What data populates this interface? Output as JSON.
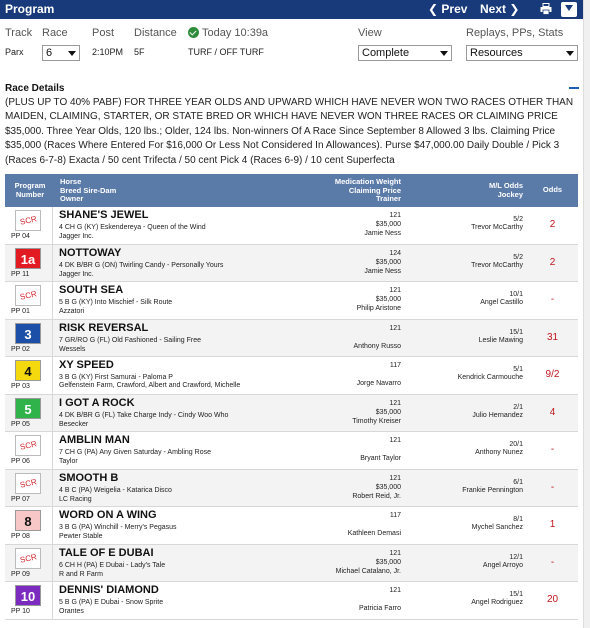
{
  "header": {
    "title": "Program",
    "prev_label": "Prev",
    "next_label": "Next"
  },
  "filters": {
    "track_label": "Track",
    "track_value": "Parx",
    "race_label": "Race",
    "race_value": "6",
    "post_label": "Post",
    "post_value": "2:10PM",
    "distance_label": "Distance",
    "distance_value": "5F",
    "status_text": "Today 10:39a",
    "surface_value": "TURF / OFF TURF",
    "view_label": "View",
    "view_value": "Complete",
    "replays_label": "Replays, PPs, Stats",
    "resources_value": "Resources"
  },
  "race_details": {
    "title": "Race Details",
    "text": "(PLUS UP TO 40% PABF) FOR THREE YEAR OLDS AND UPWARD WHICH HAVE NEVER WON TWO RACES OTHER THAN MAIDEN, CLAIMING, STARTER, OR STATE BRED OR WHICH HAVE NEVER WON THREE RACES OR CLAIMING PRICE $35,000. Three Year Olds, 120 lbs.; Older, 124 lbs. Non-winners Of A Race Since September 8 Allowed 3 lbs. Claiming Price $35,000 (Races Where Entered For $16,000 Or Less Not Considered In Allowances). Purse $47,000.00 Daily Double / Pick 3 (Races 6-7-8) Exacta / 50 cent Trifecta / 50 cent Pick 4 (Races 6-9) / 10 cent Superfecta"
  },
  "table": {
    "col_program_line1": "Program",
    "col_program_line2": "Number",
    "col_horse_line1": "Horse",
    "col_horse_line2": "Breed Sire-Dam",
    "col_horse_line3": "Owner",
    "col_mwc_line1": "Medication Weight",
    "col_mwc_line2": "Claiming Price",
    "col_mwc_line3": "Trainer",
    "col_ml_line1": "M/L Odds",
    "col_ml_line2": "Jockey",
    "col_odds": "Odds"
  },
  "colors": {
    "header_bg": "#183a7a",
    "table_header_bg": "#5a7aa8",
    "odds_red": "#c0151b",
    "scratch_red": "#d2232a"
  },
  "entries": [
    {
      "badge": "SCR",
      "scratched": true,
      "badge_bg": "#ffffff",
      "badge_fg": "#d2232a",
      "pp": "PP 04",
      "name": "SHANE'S JEWEL",
      "sire": "4 CH G (KY) Eskendereya - Queen of the Wind",
      "owner": "Jagger Inc.",
      "weight": "121",
      "claim": "$35,000",
      "trainer": "Jamie Ness",
      "ml": "5/2",
      "jockey": "Trevor McCarthy",
      "odds": "2"
    },
    {
      "badge": "1a",
      "scratched": false,
      "badge_bg": "#e21b23",
      "badge_fg": "#ffffff",
      "pp": "PP 11",
      "name": "NOTTOWAY",
      "sire": "4 DK B/BR G (ON) Twirling Candy - Personally Yours",
      "owner": "Jagger Inc.",
      "weight": "124",
      "claim": "$35,000",
      "trainer": "Jamie Ness",
      "ml": "5/2",
      "jockey": "Trevor McCarthy",
      "odds": "2"
    },
    {
      "badge": "SCR",
      "scratched": true,
      "badge_bg": "#ffffff",
      "badge_fg": "#d2232a",
      "pp": "PP 01",
      "name": "SOUTH SEA",
      "sire": "5 B G (KY) Into Mischief - Silk Route",
      "owner": "Azzatori",
      "weight": "121",
      "claim": "$35,000",
      "trainer": "Philip Aristone",
      "ml": "10/1",
      "jockey": "Angel Castillo",
      "odds": "-"
    },
    {
      "badge": "3",
      "scratched": false,
      "badge_bg": "#1c4fa8",
      "badge_fg": "#ffffff",
      "pp": "PP 02",
      "name": "RISK REVERSAL",
      "sire": "7 GR/RO G (FL) Old Fashioned - Sailing Free",
      "owner": "Wessels",
      "weight": "121",
      "claim": "",
      "trainer": "Anthony Russo",
      "ml": "15/1",
      "jockey": "Leslie Mawing",
      "odds": "31"
    },
    {
      "badge": "4",
      "scratched": false,
      "badge_bg": "#f5d90f",
      "badge_fg": "#111111",
      "pp": "PP 03",
      "name": "XY SPEED",
      "sire": "3 B G (KY) First Samurai - Paloma P",
      "owner": "Gelfenstein Farm, Crawford, Albert and Crawford, Michelle",
      "weight": "117",
      "claim": "",
      "trainer": "Jorge Navarro",
      "ml": "5/1",
      "jockey": "Kendrick Carmouche",
      "odds": "9/2"
    },
    {
      "badge": "5",
      "scratched": false,
      "badge_bg": "#2fb34a",
      "badge_fg": "#ffffff",
      "pp": "PP 05",
      "name": "I GOT A ROCK",
      "sire": "4 DK B/BR G (FL) Take Charge Indy - Cindy Woo Who",
      "owner": "Besecker",
      "weight": "121",
      "claim": "$35,000",
      "trainer": "Timothy Kreiser",
      "ml": "2/1",
      "jockey": "Julio Hernandez",
      "odds": "4"
    },
    {
      "badge": "SCR",
      "scratched": true,
      "badge_bg": "#ffffff",
      "badge_fg": "#d2232a",
      "pp": "PP 06",
      "name": "AMBLIN MAN",
      "sire": "7 CH G (PA) Any Given Saturday - Ambling Rose",
      "owner": "Taylor",
      "weight": "121",
      "claim": "",
      "trainer": "Bryant Taylor",
      "ml": "20/1",
      "jockey": "Anthony Nunez",
      "odds": "-"
    },
    {
      "badge": "SCR",
      "scratched": true,
      "badge_bg": "#ffffff",
      "badge_fg": "#d2232a",
      "pp": "PP 07",
      "name": "SMOOTH B",
      "sire": "4 B C (PA) Weigelia - Katarica Disco",
      "owner": "LC Racing",
      "weight": "121",
      "claim": "$35,000",
      "trainer": "Robert Reid, Jr.",
      "ml": "6/1",
      "jockey": "Frankie Pennington",
      "odds": "-"
    },
    {
      "badge": "8",
      "scratched": false,
      "badge_bg": "#f7c6c6",
      "badge_fg": "#111111",
      "pp": "PP 08",
      "name": "WORD ON A WING",
      "sire": "3 B G (PA) Winchill - Merry's Pegasus",
      "owner": "Pewter Stable",
      "weight": "117",
      "claim": "",
      "trainer": "Kathleen Demasi",
      "ml": "8/1",
      "jockey": "Mychel Sanchez",
      "odds": "1"
    },
    {
      "badge": "SCR",
      "scratched": true,
      "badge_bg": "#ffffff",
      "badge_fg": "#d2232a",
      "pp": "PP 09",
      "name": "TALE OF E DUBAI",
      "sire": "6 CH H (PA) E Dubai - Lady's Tale",
      "owner": "R and R Farm",
      "weight": "121",
      "claim": "$35,000",
      "trainer": "Michael Catalano, Jr.",
      "ml": "12/1",
      "jockey": "Angel Arroyo",
      "odds": "-"
    },
    {
      "badge": "10",
      "scratched": false,
      "badge_bg": "#7b2cbf",
      "badge_fg": "#ffffff",
      "pp": "PP 10",
      "name": "DENNIS' DIAMOND",
      "sire": "5 B G (PA) E Dubai - Snow Sprite",
      "owner": "Orantes",
      "weight": "121",
      "claim": "",
      "trainer": "Patricia Farro",
      "ml": "15/1",
      "jockey": "Angel Rodriguez",
      "odds": "20"
    }
  ]
}
